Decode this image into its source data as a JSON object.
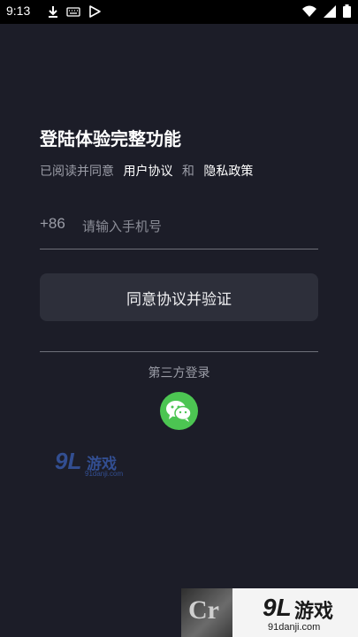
{
  "status_bar": {
    "time": "9:13",
    "left_icons": [
      "download-icon",
      "keyboard-icon",
      "play-store-icon"
    ],
    "right_icons": [
      "wifi-icon",
      "signal-icon",
      "battery-icon"
    ]
  },
  "login": {
    "title": "登陆体验完整功能",
    "agree_prefix": "已阅读并同意",
    "user_agreement": "用户协议",
    "and": "和",
    "privacy_policy": "隐私政策",
    "country_code": "+86",
    "phone_placeholder": "请输入手机号",
    "phone_value": "",
    "verify_button": "同意协议并验证",
    "third_party_label": "第三方登录",
    "third_party_icons": [
      "wechat-icon"
    ]
  },
  "watermarks": {
    "small": {
      "num": "9L",
      "text": "游戏",
      "url": "91danji.com"
    },
    "bottom": {
      "badge": "Cr",
      "num": "9L",
      "text": "游戏",
      "url": "91danji.com"
    }
  },
  "colors": {
    "background": "#1c1d28",
    "button_bg": "#2d2f3a",
    "wechat_green": "#4cc552",
    "muted_text": "#9b9da7"
  }
}
